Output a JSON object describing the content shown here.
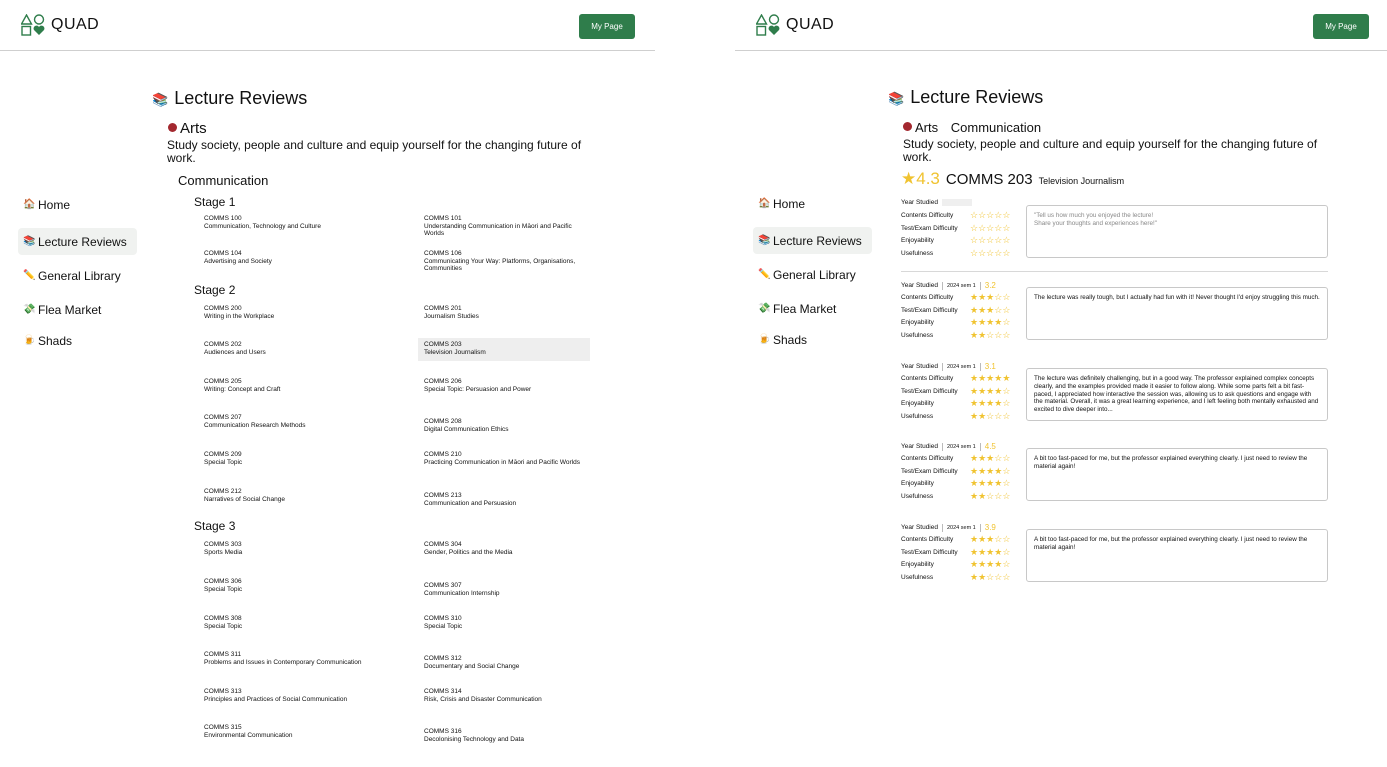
{
  "app": {
    "name": "QUAD",
    "my_page": "My Page"
  },
  "nav": [
    {
      "icon": "🏠",
      "icon_name": "house-icon",
      "label": "Home"
    },
    {
      "icon": "📚",
      "icon_name": "books-icon",
      "label": "Lecture Reviews",
      "active": true
    },
    {
      "icon": "✏️",
      "icon_name": "pencil-icon",
      "label": "General Library"
    },
    {
      "icon": "💸",
      "icon_name": "money-icon",
      "label": "Flea Market"
    },
    {
      "icon": "🍺",
      "icon_name": "beer-icon",
      "label": "Shads"
    }
  ],
  "title_icon": "📚",
  "title": "Lecture Reviews",
  "faculty": {
    "name": "Arts",
    "color": "#a3282f",
    "description": "Study society, people and culture and equip yourself for the changing future of work."
  },
  "subject": "Communication",
  "stages": [
    {
      "label": "Stage 1",
      "courses": [
        {
          "code": "COMMS 100",
          "name": "Communication, Technology and Culture"
        },
        {
          "code": "COMMS 101",
          "name": "Understanding Communication in Māori and Pacific Worlds"
        },
        {
          "code": "COMMS 104",
          "name": "Advertising and Society"
        },
        {
          "code": "COMMS 106",
          "name": "Communicating Your Way: Platforms, Organisations, Communities"
        }
      ]
    },
    {
      "label": "Stage 2",
      "courses": [
        {
          "code": "COMMS 200",
          "name": "Writing in the Workplace"
        },
        {
          "code": "COMMS 201",
          "name": "Journalism Studies"
        },
        {
          "code": "COMMS 202",
          "name": "Audiences and Users"
        },
        {
          "code": "COMMS 203",
          "name": "Television Journalism",
          "selected": true
        },
        {
          "code": "COMMS 205",
          "name": "Writing: Concept and Craft"
        },
        {
          "code": "COMMS 206",
          "name": "Special Topic: Persuasion and Power"
        },
        {
          "code": "COMMS 207",
          "name": "Communication Research Methods"
        },
        {
          "code": "COMMS 208",
          "name": "Digital Communication Ethics"
        },
        {
          "code": "COMMS 209",
          "name": "Special Topic"
        },
        {
          "code": "COMMS 210",
          "name": "Practicing Communication in Māori and Pacific Worlds"
        },
        {
          "code": "COMMS 212",
          "name": "Narratives of Social Change"
        },
        {
          "code": "COMMS 213",
          "name": "Communication and Persuasion"
        }
      ]
    },
    {
      "label": "Stage 3",
      "courses": [
        {
          "code": "COMMS 303",
          "name": "Sports Media"
        },
        {
          "code": "COMMS 304",
          "name": "Gender, Politics and the Media"
        },
        {
          "code": "COMMS 306",
          "name": "Special Topic"
        },
        {
          "code": "COMMS 307",
          "name": "Communication Internship"
        },
        {
          "code": "COMMS 308",
          "name": "Special Topic"
        },
        {
          "code": "COMMS 310",
          "name": "Special Topic"
        },
        {
          "code": "COMMS 311",
          "name": "Problems and Issues in Contemporary Communication"
        },
        {
          "code": "COMMS 312",
          "name": "Documentary and Social Change"
        },
        {
          "code": "COMMS 313",
          "name": "Principles and Practices of Social Communication"
        },
        {
          "code": "COMMS 314",
          "name": "Risk, Crisis and Disaster Communication"
        },
        {
          "code": "COMMS 315",
          "name": "Environmental Communication"
        },
        {
          "code": "COMMS 316",
          "name": "Decolonising Technology and Data"
        }
      ]
    }
  ],
  "detail": {
    "breadcrumb_subject": "Communication",
    "rating": "4.3",
    "code": "COMMS 203",
    "course_name": "Television Journalism",
    "criteria": [
      "Contents Difficulty",
      "Test/Exam Difficulty",
      "Enjoyability",
      "Usefulness"
    ],
    "year_label": "Year Studied",
    "star_color": "#f0c330",
    "new_review": {
      "placeholder": "\"Tell us how much you enjoyed the lecture!\nShare your thoughts and experiences here!\"",
      "ratings": [
        0,
        0,
        0,
        0
      ]
    },
    "reviews": [
      {
        "semester": "2024 sem 1",
        "score": "3.2",
        "ratings": [
          3,
          3,
          4,
          2
        ],
        "text": "The lecture was really tough, but I actually had fun with it! Never thought I'd enjoy struggling this much."
      },
      {
        "semester": "2024 sem 1",
        "score": "3.1",
        "ratings": [
          5,
          4,
          4,
          2
        ],
        "text": "The lecture was definitely challenging, but in a good way. The professor explained complex concepts clearly, and the examples provided made it easier to follow along. While some parts felt a bit fast-paced, I appreciated how interactive the session was, allowing us to ask questions and engage with the material. Overall, it was a great learning experience, and I left feeling both mentally exhausted and excited to dive deeper into..."
      },
      {
        "semester": "2024 sem 1",
        "score": "4.5",
        "ratings": [
          3,
          4,
          4,
          2
        ],
        "text": "A bit too fast-paced for me, but the professor explained everything clearly. I just need to review the material again!"
      },
      {
        "semester": "2024 sem 1",
        "score": "3.9",
        "ratings": [
          3,
          4,
          4,
          2
        ],
        "text": "A bit too fast-paced for me, but the professor explained everything clearly. I just need to review the material again!"
      }
    ]
  }
}
